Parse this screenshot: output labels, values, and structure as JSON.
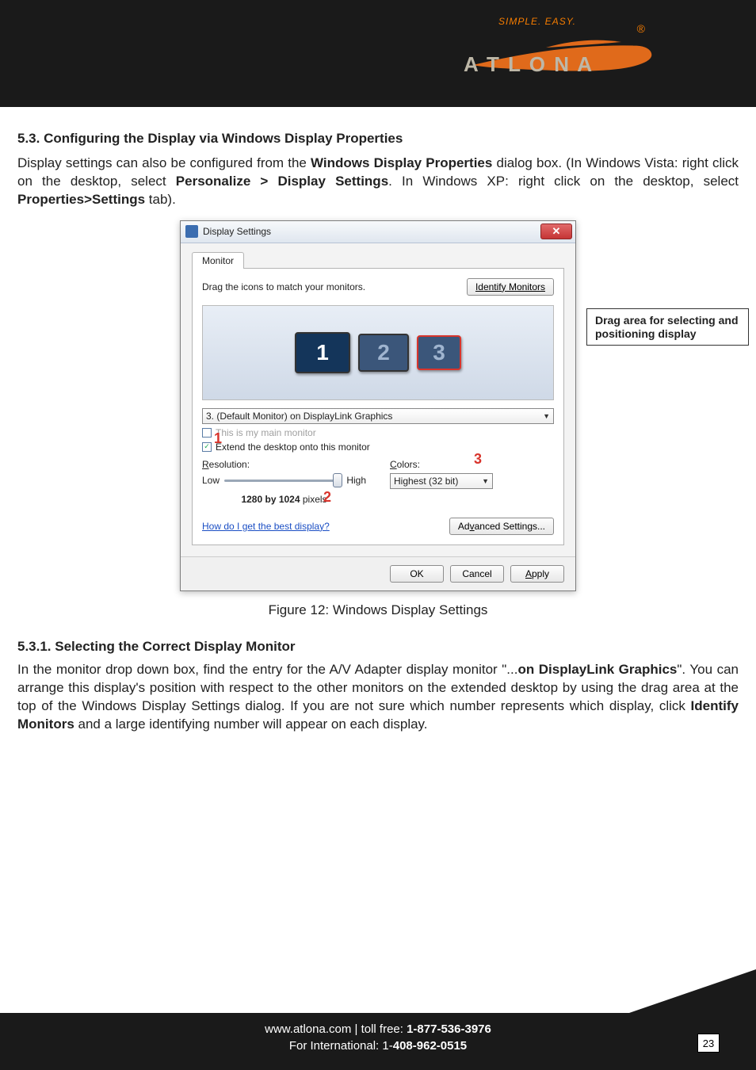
{
  "brand": {
    "tagline": "SIMPLE. EASY.",
    "name": "ATLONA",
    "registered": "®"
  },
  "section": {
    "heading": "5.3. Configuring the Display via Windows Display Properties",
    "p1_a": "Display settings can also be configured from the ",
    "p1_b": "Windows Display Properties",
    "p1_c": " dialog box. (In Windows Vista: right click on the desktop, select ",
    "p1_d": "Personalize > Display Settings",
    "p1_e": ". In Windows XP: right click on the desktop, select ",
    "p1_f": "Properties>Settings",
    "p1_g": " tab)."
  },
  "dialog": {
    "title": "Display Settings",
    "close": "✕",
    "tab": "Monitor",
    "instr": "Drag the icons to match your monitors.",
    "identify": "Identify Monitors",
    "mon1": "1",
    "mon2": "2",
    "mon3": "3",
    "dropdown": "3. (Default Monitor) on DisplayLink Graphics",
    "cb_main": "This is my main monitor",
    "cb_extend": "Extend the desktop onto this monitor",
    "res_label_u": "R",
    "res_label": "esolution:",
    "low": "Low",
    "high": "High",
    "res_value_a": "1280 by 1024",
    "res_value_b": " pixels",
    "colors_label_u": "C",
    "colors_label": "olors:",
    "colors_value": "Highest (32 bit)",
    "help": "How do I get the best display?",
    "adv_a": "Ad",
    "adv_u": "v",
    "adv_b": "anced Settings...",
    "ok": "OK",
    "cancel": "Cancel",
    "apply_a": "A",
    "apply_b": "pply"
  },
  "callouts": {
    "c1": "1",
    "c2": "2",
    "c3": "3",
    "drag": "Drag area for selecting and positioning display"
  },
  "caption": "Figure 12: Windows Display Settings",
  "sub": {
    "heading": "5.3.1. Selecting the Correct Display Monitor",
    "p_a": "In the monitor drop down box, find the entry for the A/V Adapter display monitor \"...",
    "p_b": "on DisplayLink Graphics",
    "p_c": "\". You can arrange this display's position with respect to the other monitors on the extended desktop by using the drag area at the top of the Windows Display Settings dialog. If you are not sure which number represents which display, click ",
    "p_d": "Identify Monitors",
    "p_e": " and a large identifying number will appear on each display."
  },
  "footer": {
    "l1_a": "www.atlona.com | toll free: ",
    "l1_b": "1-877-536-3976",
    "l2_a": "For International: 1-",
    "l2_b": "408-962-0515",
    "page": "23"
  }
}
